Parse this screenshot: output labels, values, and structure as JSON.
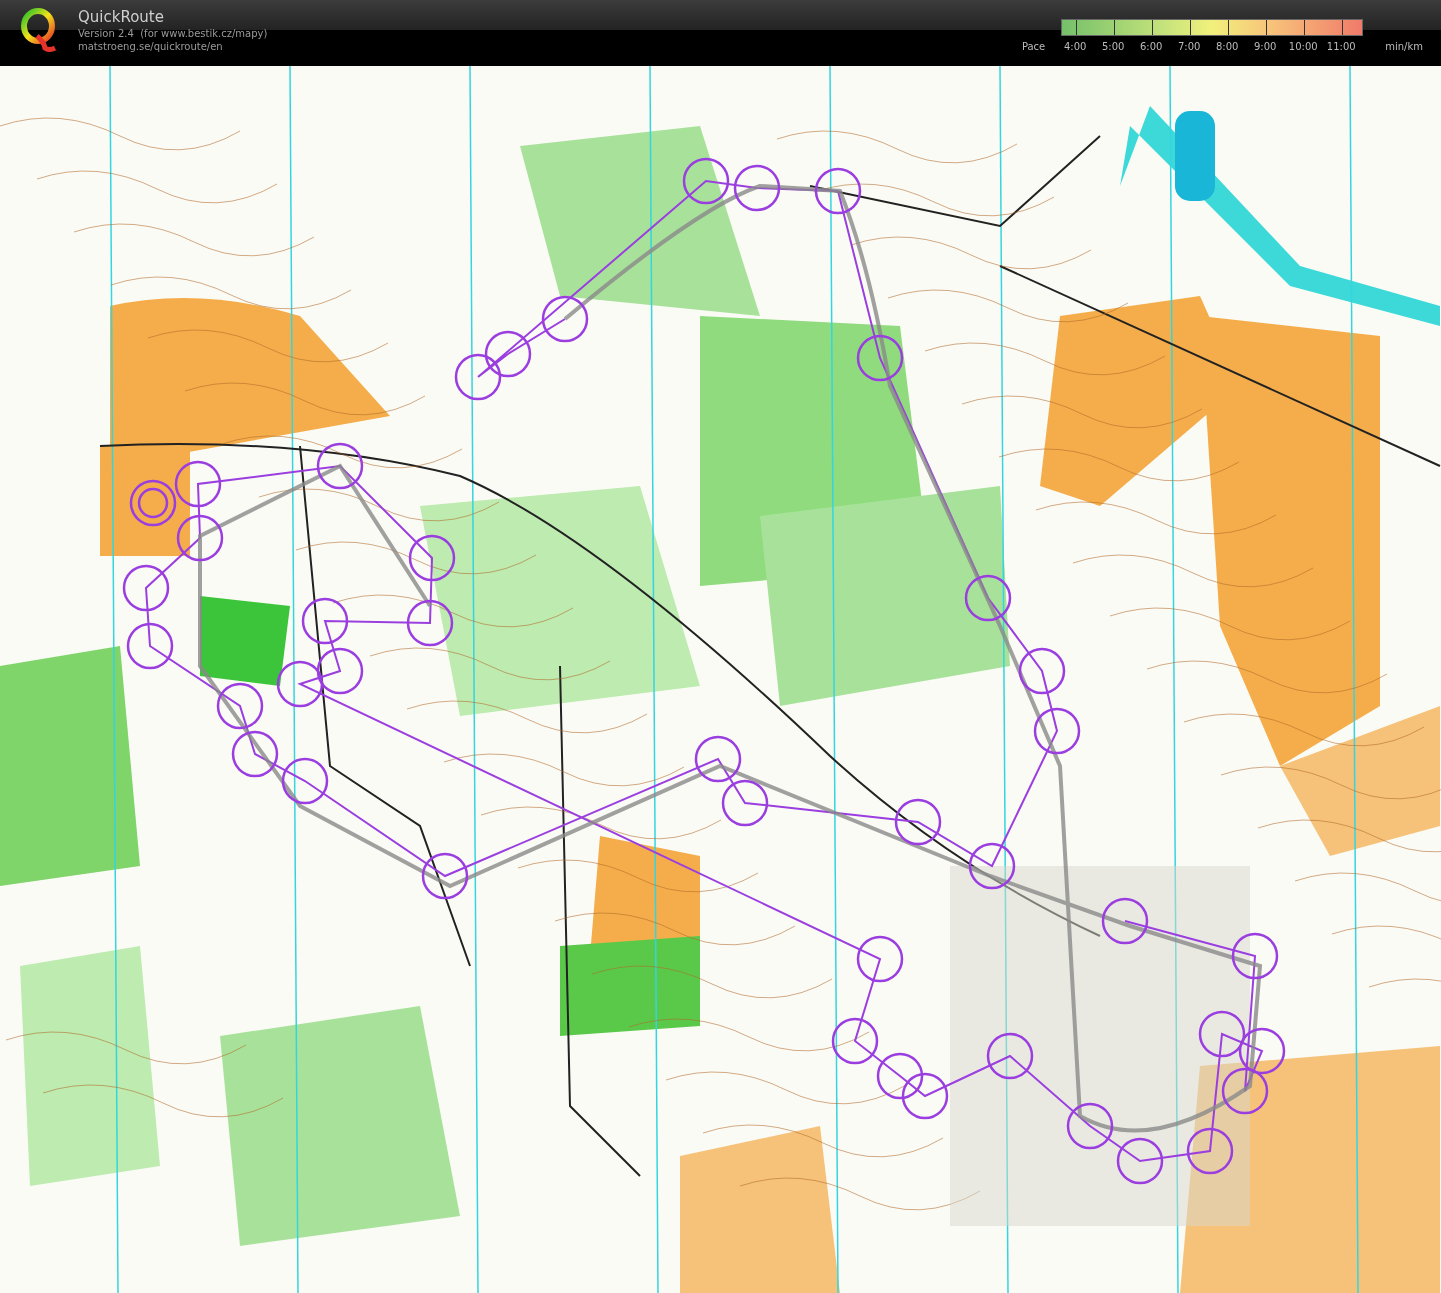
{
  "header": {
    "app_title": "QuickRoute",
    "version_line": "Version 2.4  (for www.bestik.cz/mapy)",
    "url": "matstroeng.se/quickroute/en"
  },
  "pace_legend": {
    "label": "Pace",
    "ticks": [
      "4:00",
      "5:00",
      "6:00",
      "7:00",
      "8:00",
      "9:00",
      "10:00",
      "11:00"
    ],
    "unit": "min/km"
  }
}
